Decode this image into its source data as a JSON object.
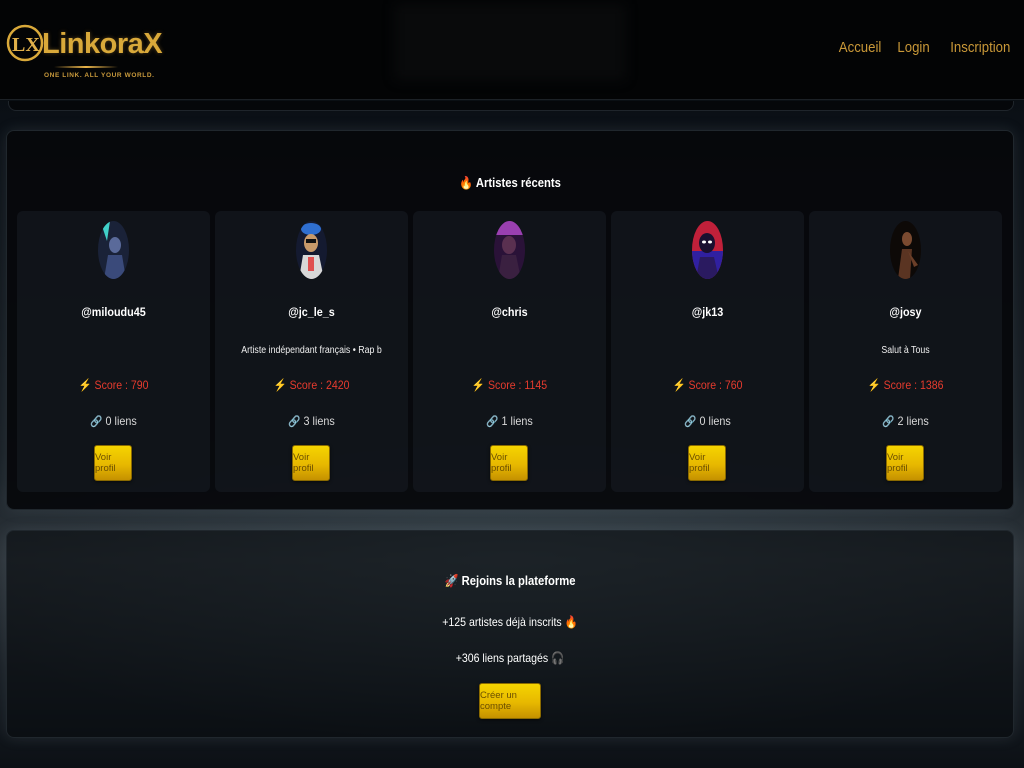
{
  "header": {
    "logo_name": "LinkoraX",
    "logo_tagline": "ONE LINK. ALL YOUR WORLD.",
    "nav": [
      "Accueil",
      "Login",
      "Inscription"
    ]
  },
  "artists_section": {
    "icon": "fire-icon",
    "title": "Artistes récents",
    "cards": [
      {
        "handle": "@miloudu45",
        "bio": "",
        "score": "Score : 790",
        "links": "0 liens",
        "button": "Voir profil",
        "avatar_color": "#3a4a7a"
      },
      {
        "handle": "@jc_le_s",
        "bio": "Artiste indépendant français • Rap b",
        "score": "Score : 2420",
        "links": "3 liens",
        "button": "Voir profil",
        "avatar_color": "#2a3d6a"
      },
      {
        "handle": "@chris",
        "bio": "",
        "score": "Score : 1145",
        "links": "1 liens",
        "button": "Voir profil",
        "avatar_color": "#7a2e8a"
      },
      {
        "handle": "@jk13",
        "bio": "",
        "score": "Score : 760",
        "links": "0 liens",
        "button": "Voir profil",
        "avatar_color": "#c0203a"
      },
      {
        "handle": "@josy",
        "bio": "Salut à Tous",
        "score": "Score : 1386",
        "links": "2 liens",
        "button": "Voir profil",
        "avatar_color": "#2a1a14"
      }
    ]
  },
  "join_section": {
    "icon": "rocket-icon",
    "title": "Rejoins la plateforme",
    "artists_count": "+125 artistes déjà inscrits",
    "links_count": "+306 liens partagés",
    "button": "Créer un compte"
  },
  "colors": {
    "accent_gold": "#c99838",
    "score_red": "#e63b2e",
    "button_yellow": "#e7b800"
  }
}
